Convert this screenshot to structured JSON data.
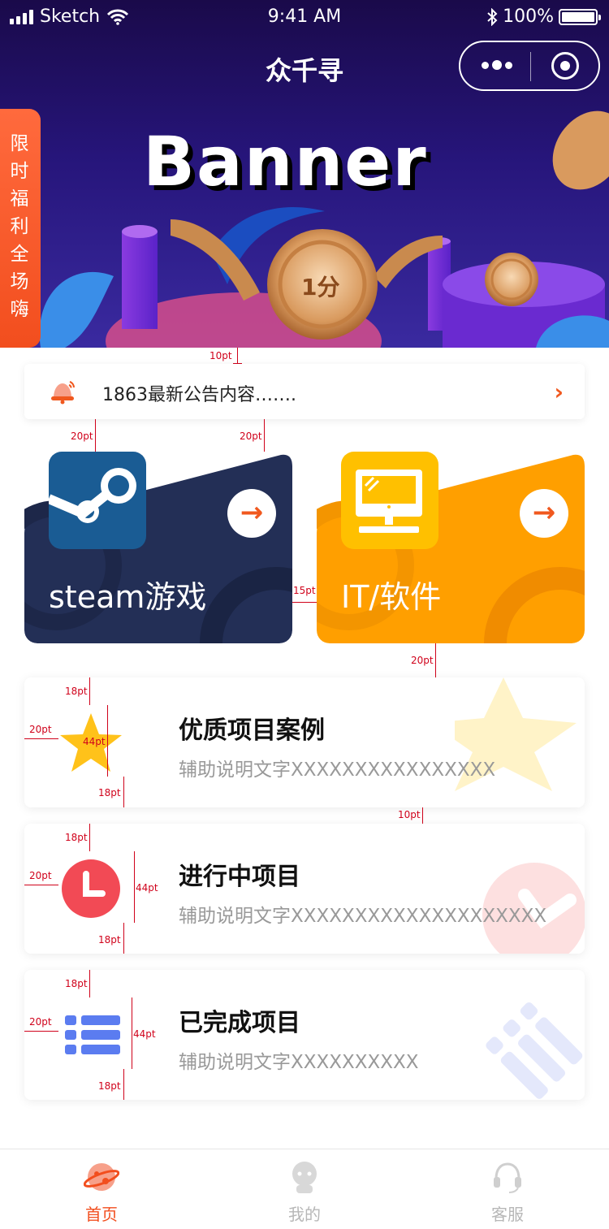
{
  "status_bar": {
    "carrier": "Sketch",
    "time": "9:41 AM",
    "battery": "100%"
  },
  "header": {
    "title": "众千寻"
  },
  "banner": {
    "text": "Banner",
    "coin_label": "1分"
  },
  "side_tab": {
    "label": "限时福利全场嗨"
  },
  "notice": {
    "text": "1863最新公告内容……."
  },
  "categories": [
    {
      "label": "steam游戏",
      "color": "#232f56",
      "icon": "steam-icon"
    },
    {
      "label": "IT/软件",
      "color": "#ff9f00",
      "icon": "monitor-icon"
    }
  ],
  "projects": [
    {
      "title": "优质项目案例",
      "subtitle": "辅助说明文字XXXXXXXXXXXXXXXX",
      "icon": "star-icon"
    },
    {
      "title": "进行中项目",
      "subtitle": "辅助说明文字XXXXXXXXXXXXXXXXXXXX",
      "icon": "clock-icon"
    },
    {
      "title": "已完成项目",
      "subtitle": "辅助说明文字XXXXXXXXXX",
      "icon": "list-icon"
    }
  ],
  "annotations": {
    "gap_10": "10pt",
    "gap_20": "20pt",
    "gap_15": "15pt",
    "gap_18": "18pt",
    "size_44": "44pt"
  },
  "tabbar": {
    "items": [
      {
        "label": "首页",
        "active": true,
        "icon": "planet-icon"
      },
      {
        "label": "我的",
        "active": false,
        "icon": "robot-icon"
      },
      {
        "label": "客服",
        "active": false,
        "icon": "headset-icon"
      }
    ]
  },
  "colors": {
    "accent": "#f0581e",
    "active_tab": "#f24e1e",
    "inactive_tab": "#b7b7b7"
  }
}
